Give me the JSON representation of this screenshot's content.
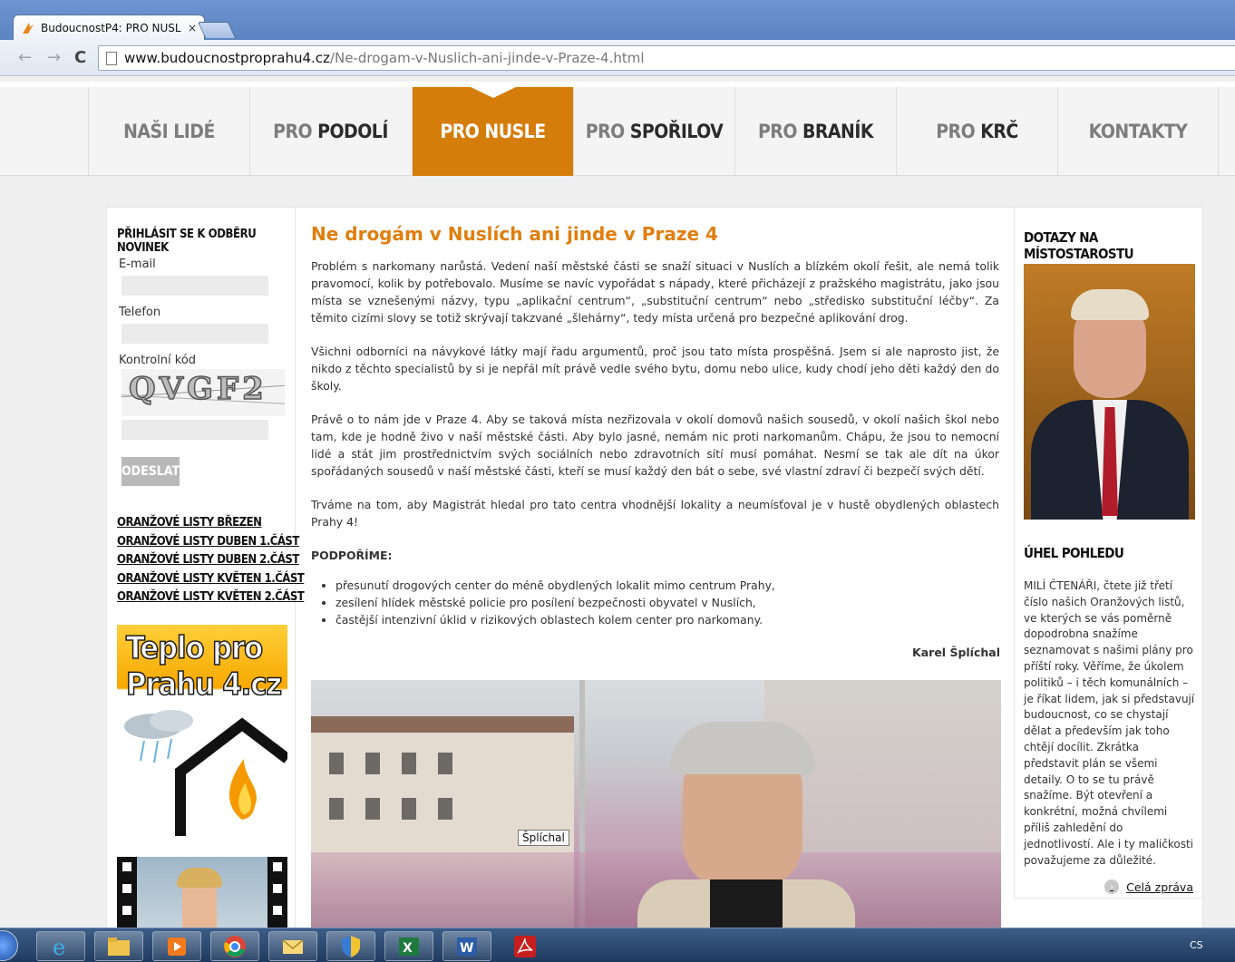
{
  "browser": {
    "tab_title": "BudoucnostP4: PRO NUSL",
    "tab_close": "×",
    "url_host": "www.budoucnostproprahu4.cz",
    "url_path": "/Ne-drogam-v-Nuslich-ani-jinde-v-Praze-4.html",
    "back": "←",
    "forward": "→",
    "reload": "C"
  },
  "nav": {
    "naši_lidé": "NAŠI LIDÉ",
    "pro": "PRO",
    "podoli": "PODOLÍ",
    "nusle": "NUSLE",
    "sporilov": "SPOŘILOV",
    "branik": "BRANÍK",
    "krc": "KRČ",
    "kontakty": "KONTAKTY"
  },
  "subscribe": {
    "heading": "PŘIHLÁSIT SE K ODBĚRU NOVINEK",
    "email_label": "E-mail",
    "phone_label": "Telefon",
    "captcha_label": "Kontrolní kód",
    "captcha_text": "QVGF2",
    "submit": "ODESLAT"
  },
  "leaflets": [
    "ORANŽOVÉ LISTY BŘEZEN",
    "ORANŽOVÉ LISTY DUBEN  1.ČÁST",
    "ORANŽOVÉ LISTY DUBEN  2.ČÁST",
    "ORANŽOVÉ LISTY KVĚTEN 1.ČÁST",
    "ORANŽOVÉ LISTY KVĚTEN 2.ČÁST"
  ],
  "banner": {
    "line1": "Teplo pro",
    "line2": "Prahu 4.cz"
  },
  "article": {
    "title": "Ne drogám v Nuslích ani jinde v Praze 4",
    "p1": "Problém s narkomany narůstá. Vedení naší městské části se snaží situaci v Nuslích a blízkém okolí řešit, ale nemá tolik pravomocí, kolik by potřebovalo. Musíme se navíc vypořádat s nápady, které přicházejí z pražského magistrátu, jako jsou místa se vznešenými názvy, typu „aplikační centrum“, „substituční centrum“ nebo „středisko substituční léčby“. Za těmito cizími slovy se totiž skrývají takzvané „šlehárny“, tedy místa určená pro bezpečné aplikování drog.",
    "p2": "Všichni odborníci na návykové látky mají řadu argumentů, proč jsou tato místa prospěšná. Jsem si ale naprosto jist, že nikdo z těchto specialistů by si je nepřál mít právě vedle svého bytu, domu nebo ulice, kudy chodí jeho děti každý den do školy.",
    "p3": "Právě o to nám jde v Praze 4. Aby se taková místa nezřizovala v okolí domovů našich sousedů, v okolí našich škol nebo tam, kde je hodně živo v naší městské části. Aby bylo jasné, nemám nic proti narkomanům. Chápu, že jsou to nemocní lidé a stát jim prostřednictvím svých sociálních nebo zdravotních sítí musí pomáhat. Nesmí se tak ale dít na úkor spořádaných sousedů v naší městské části, kteří se musí každý den bát o sebe, své vlastní zdraví či bezpečí svých dětí.",
    "p4": "Trváme na tom, aby Magistrát hledal pro tato centra vhodnější lokality a neumísťoval je v hustě obydlených oblastech Prahy 4!",
    "subheading": "PODPOŘÍME:",
    "bullets": [
      "přesunutí drogových center do méně obydlených lokalit mimo centrum Prahy,",
      "zesílení hlídek městské policie pro posílení bezpečnosti obyvatel v Nuslích,",
      "častější intenzivní úklid v rizikových oblastech kolem center pro narkomany."
    ],
    "author": "Karel Šplíchal",
    "photo_tooltip": "Šplíchal"
  },
  "right": {
    "questions_heading": "DOTAZY NA MÍSTOSTAROSTU",
    "view_heading": "ÚHEL POHLEDU",
    "text": "MILÍ ČTENÁŘI, čtete již třetí číslo našich Oranžových listů, ve kterých se vás poměrně dopodrobna snažíme seznamovat s našimi plány pro příští roky. Věříme, že úkolem politiků – i těch komunálních – je říkat lidem, jak si představují budoucnost, co se chystají dělat a především jak toho chtějí docílit. Zkrátka představit plán se všemi detaily. O to se tu právě snažíme. Být otevření a konkrétní, možná chvílemi příliš zahledění do jednotlivostí. Ale i ty maličkosti považujeme za důležité.",
    "more": "Celá zpráva"
  },
  "taskbar": {
    "lang": "CS"
  },
  "colors": {
    "accent": "#d57d0a",
    "title": "#e07e0e"
  }
}
